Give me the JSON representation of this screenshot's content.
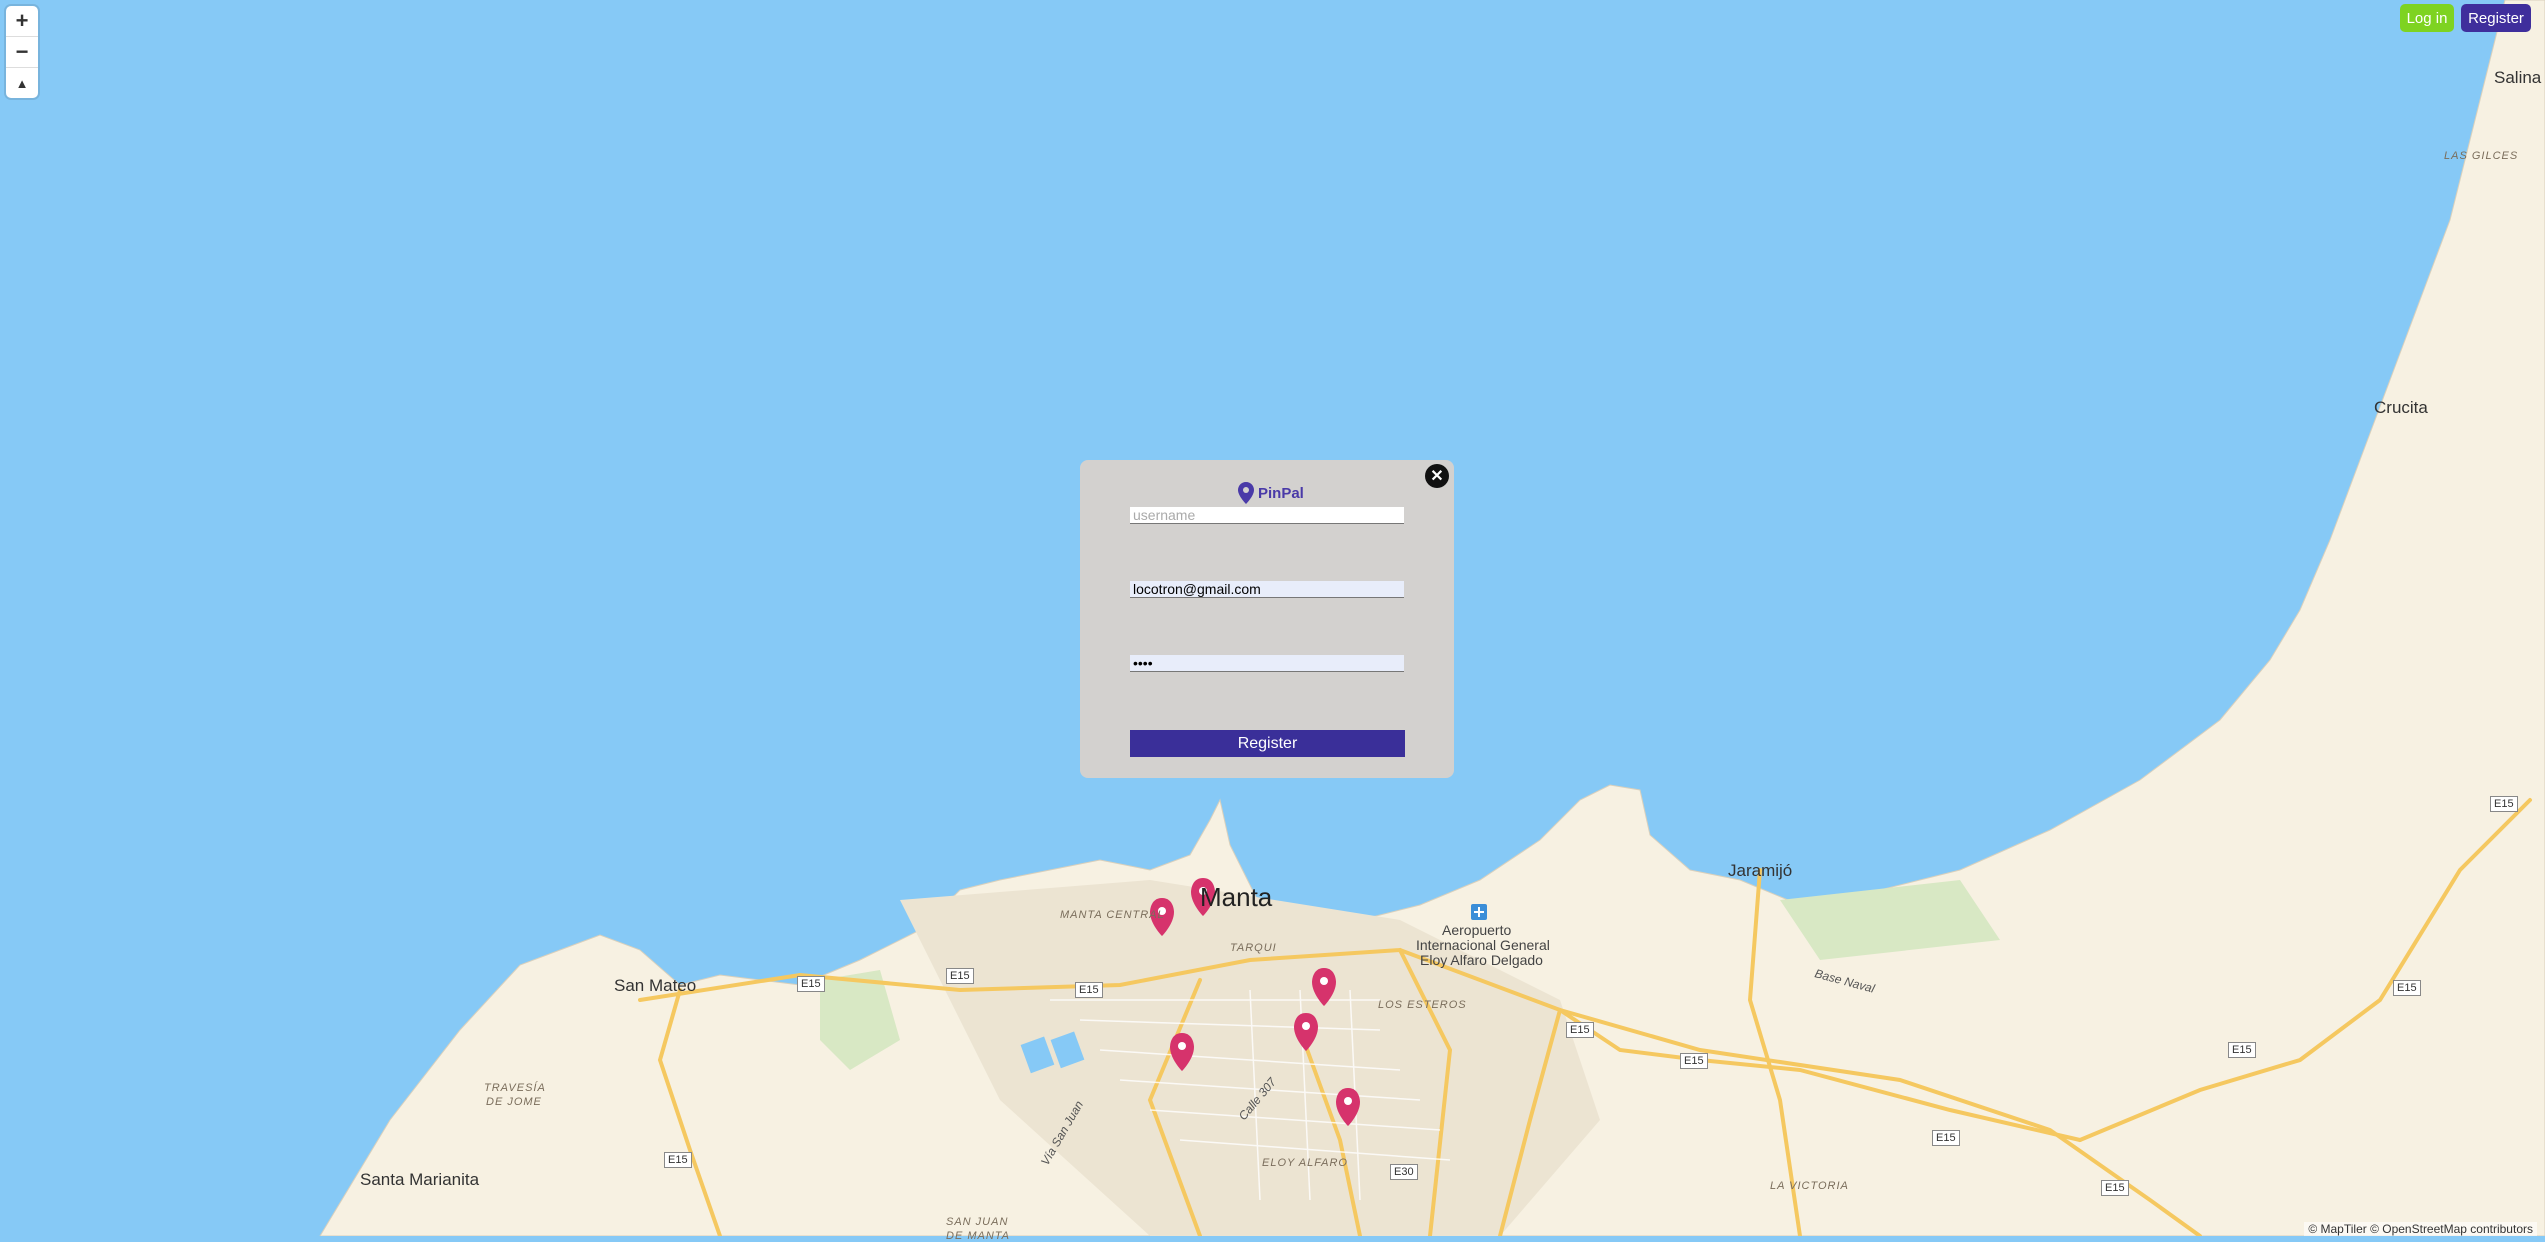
{
  "map": {
    "labels": {
      "manta": "Manta",
      "manta_central": "MANTA CENTRAL",
      "tarqui": "TARQUI",
      "san_mateo": "San Mateo",
      "santa_marianita": "Santa Marianita",
      "travesia": "TRAVESÍA",
      "de_jome": "DE JOME",
      "jaramijo": "Jaramijó",
      "crucita": "Crucita",
      "salina": "Salina",
      "las_gilces": "LAS GILCES",
      "airport_1": "Aeropuerto",
      "airport_2": "Internacional General",
      "airport_3": "Eloy Alfaro Delgado",
      "los_esteros": "LOS ESTEROS",
      "eloy_alfaro": "ELOY ALFARO",
      "base_naval": "Base Naval",
      "la_victoria": "LA VICTORIA",
      "calle_307": "Calle 307",
      "via_san_juan": "Vía San Juan",
      "san_juan_1": "SAN JUAN",
      "san_juan_2": "DE MANTA",
      "e15": "E15",
      "e30": "E30"
    },
    "attribution": "© MapTiler © OpenStreetMap contributors",
    "pin_color": "#d6336c"
  },
  "controls": {
    "zoom_in": "+",
    "zoom_out": "−",
    "reset_north": "▲"
  },
  "header": {
    "login_label": "Log in",
    "register_label": "Register"
  },
  "register_modal": {
    "close": "✕",
    "app_name": "PinPal",
    "username_placeholder": "username",
    "username_value": "",
    "email_value": "locotron@gmail.com",
    "password_value": "••••",
    "submit_label": "Register"
  },
  "colors": {
    "water": "#86c9f6",
    "land": "#f7f1e2",
    "login": "#7ed321",
    "primary": "#3f2e9c"
  }
}
